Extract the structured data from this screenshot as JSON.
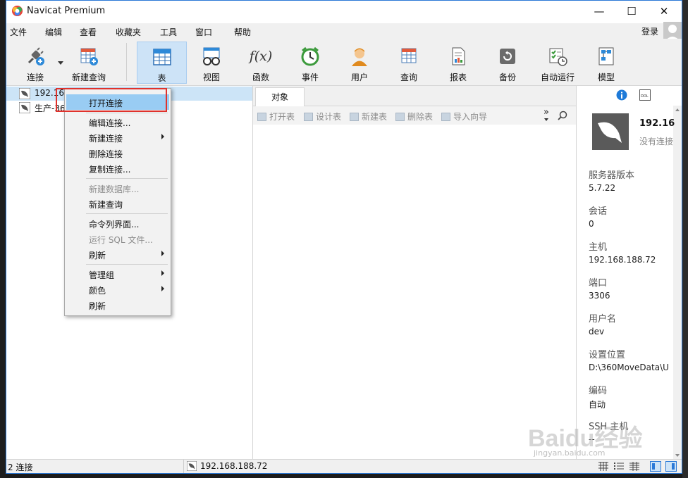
{
  "window": {
    "title": "Navicat Premium",
    "minimize": "—",
    "maximize": "☐",
    "close": "✕"
  },
  "menu": {
    "items": [
      "文件",
      "编辑",
      "查看",
      "收藏夹",
      "工具",
      "窗口",
      "帮助"
    ],
    "login": "登录"
  },
  "toolbar": {
    "buttons": [
      {
        "label": "连接",
        "icon": "plug-icon"
      },
      {
        "label": "新建查询",
        "icon": "new-query-icon"
      },
      {
        "label": "表",
        "icon": "table-icon"
      },
      {
        "label": "视图",
        "icon": "view-icon"
      },
      {
        "label": "函数",
        "icon": "function-icon"
      },
      {
        "label": "事件",
        "icon": "clock-icon"
      },
      {
        "label": "用户",
        "icon": "user-icon"
      },
      {
        "label": "查询",
        "icon": "query-icon"
      },
      {
        "label": "报表",
        "icon": "report-icon"
      },
      {
        "label": "备份",
        "icon": "backup-icon"
      },
      {
        "label": "自动运行",
        "icon": "schedule-icon"
      },
      {
        "label": "模型",
        "icon": "model-icon"
      }
    ],
    "function_glyph": "f(x)"
  },
  "connections": [
    {
      "name": "192.168.188.72"
    },
    {
      "name": "生产-36"
    }
  ],
  "context_menu": {
    "items": [
      {
        "label": "打开连接",
        "state": "highlighted"
      },
      {
        "label": "编辑连接..."
      },
      {
        "label": "新建连接"
      },
      {
        "label": "删除连接"
      },
      {
        "label": "复制连接..."
      },
      {
        "label": "新建数据库...",
        "state": "disabled"
      },
      {
        "label": "新建查询"
      },
      {
        "label": "命令列界面..."
      },
      {
        "label": "运行 SQL 文件...",
        "state": "disabled"
      },
      {
        "label": "刷新"
      },
      {
        "label": "管理组"
      },
      {
        "label": "颜色"
      },
      {
        "label": "刷新"
      }
    ]
  },
  "objects": {
    "tab": "对象",
    "actions": [
      "打开表",
      "设计表",
      "新建表",
      "删除表",
      "导入向导"
    ],
    "more": "»"
  },
  "info": {
    "header_name": "192.16",
    "header_status": "没有连接",
    "fields": [
      {
        "key": "服务器版本",
        "value": "5.7.22"
      },
      {
        "key": "会话",
        "value": "0"
      },
      {
        "key": "主机",
        "value": "192.168.188.72"
      },
      {
        "key": "端口",
        "value": "3306"
      },
      {
        "key": "用户名",
        "value": "dev"
      },
      {
        "key": "设置位置",
        "value": "D:\\360MoveData\\U"
      },
      {
        "key": "编码",
        "value": "自动"
      },
      {
        "key": "SSH 主机",
        "value": "--"
      }
    ]
  },
  "status": {
    "connections": "2 连接",
    "current": "192.168.188.72"
  },
  "watermark": {
    "text": "Baidu经验",
    "url": "jingyan.baidu.com"
  },
  "colors": {
    "accent": "#2b79d7",
    "selection": "#cce4f7",
    "highlight": "#99ccf3",
    "red_box": "#e0322c"
  }
}
